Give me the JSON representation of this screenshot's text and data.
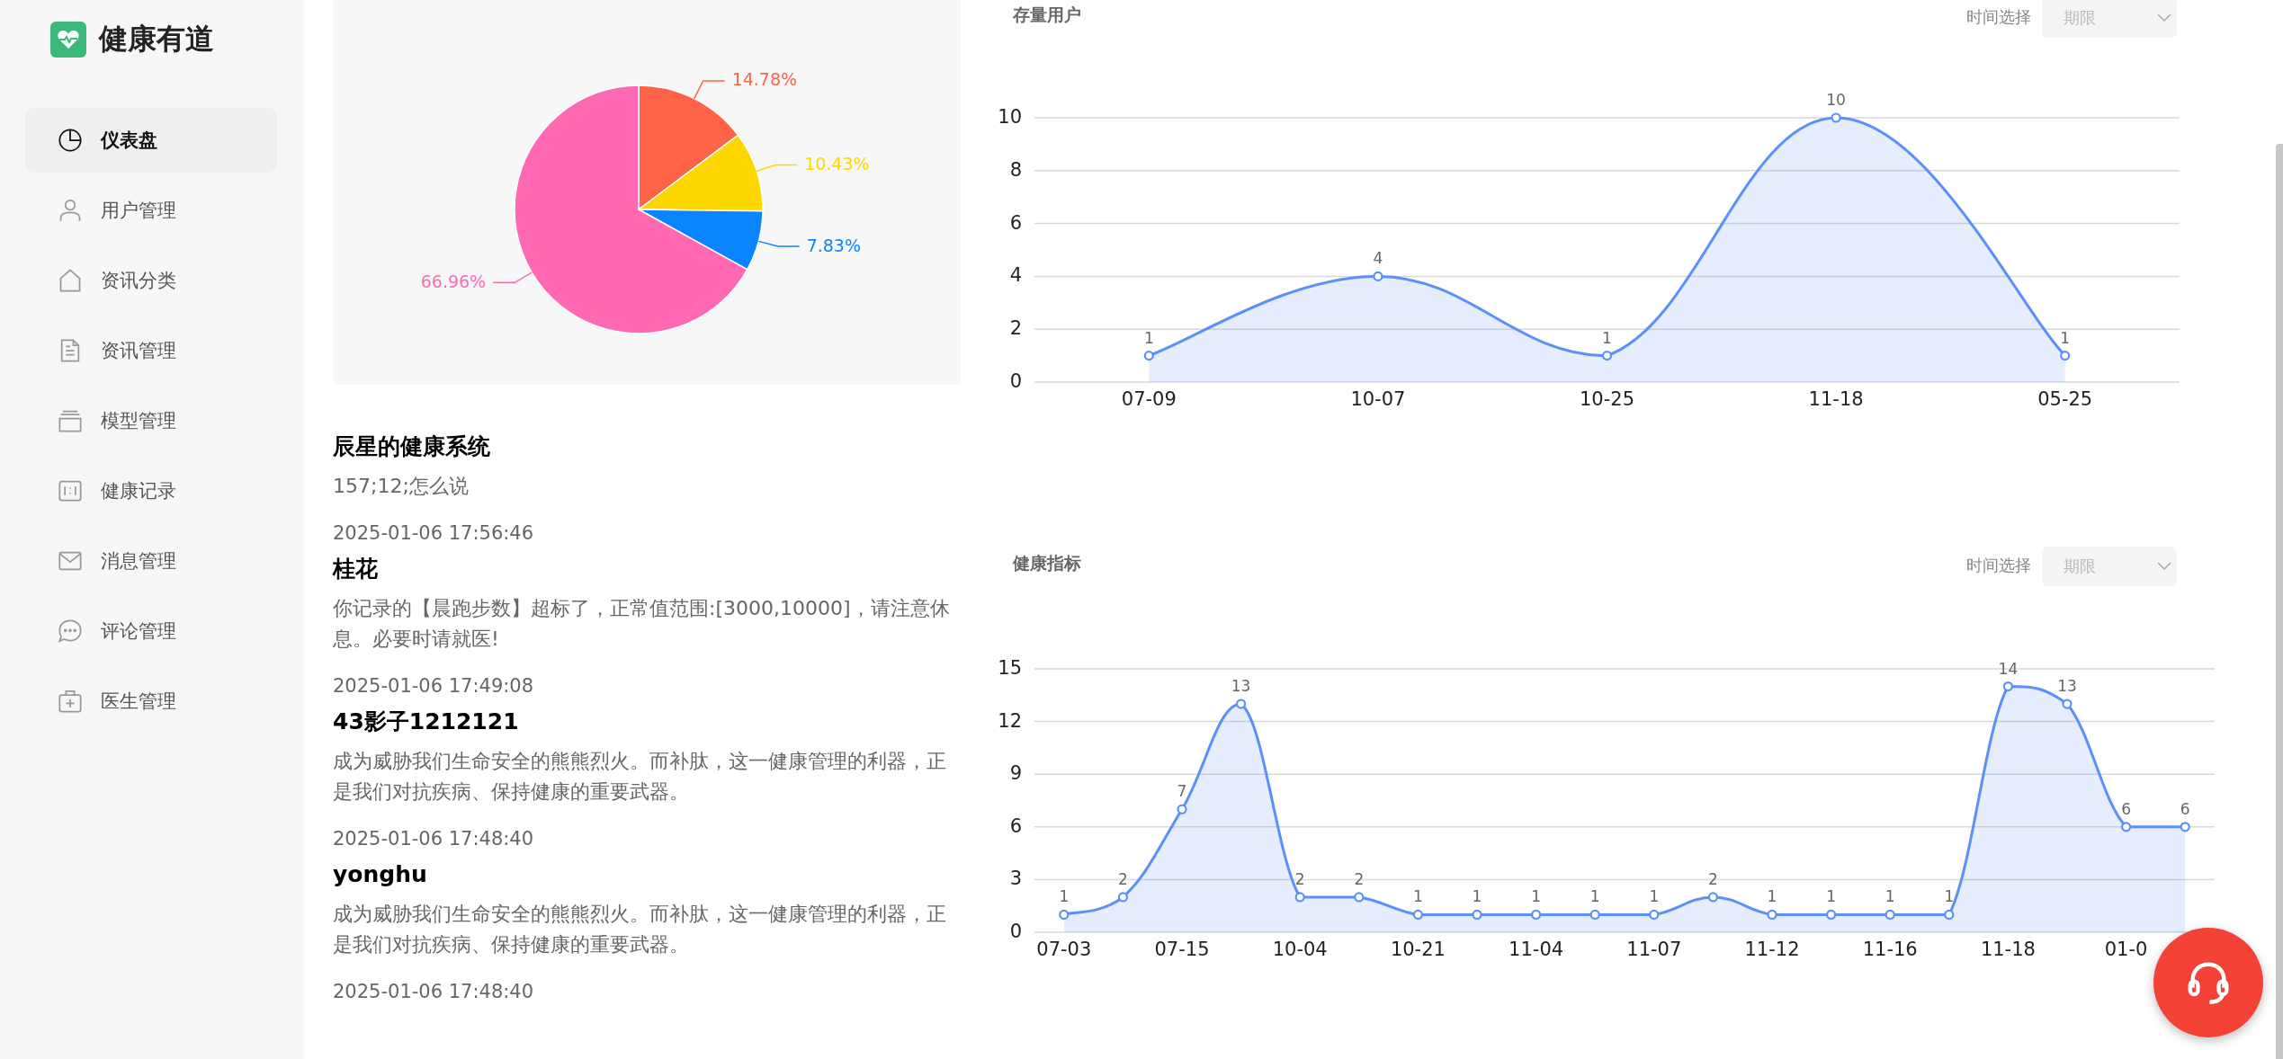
{
  "sidebar": {
    "brand": "健康有道",
    "items": [
      {
        "label": "仪表盘",
        "selected": true
      },
      {
        "label": "用户管理",
        "selected": false
      },
      {
        "label": "资讯分类",
        "selected": false
      },
      {
        "label": "资讯管理",
        "selected": false
      },
      {
        "label": "模型管理",
        "selected": false
      },
      {
        "label": "健康记录",
        "selected": false
      },
      {
        "label": "消息管理",
        "selected": false
      },
      {
        "label": "评论管理",
        "selected": false
      },
      {
        "label": "医生管理",
        "selected": false
      }
    ]
  },
  "pie": {
    "chart_data": {
      "type": "pie",
      "values": [
        14.78,
        10.43,
        7.83,
        66.96
      ],
      "value_labels": [
        "14.78%",
        "10.43%",
        "7.83%",
        "66.96%"
      ],
      "colors": [
        "#ff6347",
        "#ffd700",
        "#0a84ff",
        "#ff69b4"
      ]
    }
  },
  "messages": [
    {
      "title": "辰星的健康系统",
      "body": "157;12;怎么说",
      "time": "2025-01-06 17:56:46"
    },
    {
      "title": "桂花",
      "body": "你记录的【晨跑步数】超标了，正常值范围:[3000,10000]，请注意休息。必要时请就医!",
      "time": "2025-01-06 17:49:08"
    },
    {
      "title": "43影子1212121",
      "body": "成为威胁我们生命安全的熊熊烈火。而补肽，这一健康管理的利器，正是我们对抗疾病、保持健康的重要武器。",
      "time": "2025-01-06 17:48:40"
    },
    {
      "title": "yonghu",
      "body": "成为威胁我们生命安全的熊熊烈火。而补肽，这一健康管理的利器，正是我们对抗疾病、保持健康的重要武器。",
      "time": "2025-01-06 17:48:40"
    }
  ],
  "charts": [
    {
      "title": "存量用户",
      "filter_label": "时间选择",
      "select_placeholder": "期限",
      "chart_data": {
        "type": "area",
        "categories": [
          "07-09",
          "10-07",
          "10-25",
          "11-18",
          "05-25"
        ],
        "ylim": [
          0,
          10
        ],
        "grid": true,
        "yticks": [
          0,
          2,
          4,
          6,
          8,
          10
        ],
        "data_labels": true,
        "series": [
          {
            "color": "#5b8ff9",
            "values": [
              1,
              4,
              1,
              10,
              1
            ]
          }
        ]
      }
    },
    {
      "title": "健康指标",
      "filter_label": "时间选择",
      "select_placeholder": "期限",
      "chart_data": {
        "type": "area",
        "categories": [
          "07-03",
          null,
          "07-15",
          null,
          "10-04",
          null,
          "10-21",
          null,
          "11-04",
          null,
          "11-07",
          null,
          "11-12",
          null,
          "11-16",
          null,
          "11-18",
          null,
          "01-0",
          null
        ],
        "ylim": [
          0,
          15
        ],
        "grid": true,
        "yticks": [
          0,
          3,
          6,
          9,
          12,
          15
        ],
        "data_labels": true,
        "series": [
          {
            "color": "#5b8ff9",
            "values": [
              1,
              2,
              7,
              13,
              2,
              2,
              1,
              1,
              1,
              1,
              1,
              2,
              1,
              1,
              1,
              1,
              14,
              13,
              6,
              6
            ]
          }
        ]
      }
    }
  ]
}
